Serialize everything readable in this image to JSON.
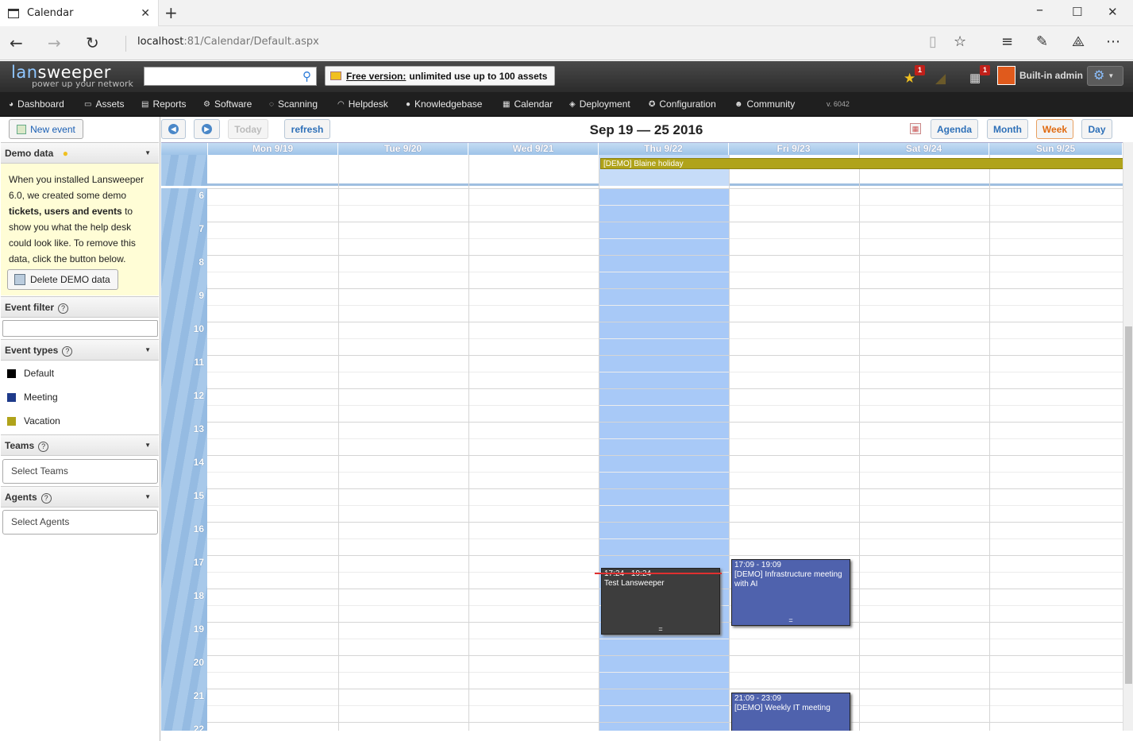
{
  "browser": {
    "tab_title": "Calendar",
    "url_host": "localhost",
    "url_rest": ":81/Calendar/Default.aspx"
  },
  "header": {
    "logo_lan": "lan",
    "logo_rest": "sweeper",
    "tagline": "power up your network",
    "free_label": "Free version:",
    "free_text": "unlimited use up to 100 assets",
    "notif_badge_1": "1",
    "notif_badge_2": "1",
    "username": "Built-in admin"
  },
  "nav": {
    "items": [
      "Dashboard",
      "Assets",
      "Reports",
      "Software",
      "Scanning",
      "Helpdesk",
      "Knowledgebase",
      "Calendar",
      "Deployment",
      "Configuration",
      "Community"
    ],
    "version": "v. 6042"
  },
  "sidebar": {
    "new_event": "New event",
    "demo_title": "Demo data",
    "demo_text_1": "When you installed Lansweeper 6.0, we created some demo ",
    "demo_bold": "tickets, users and events",
    "demo_text_2": " to show you what the help desk could look like. To remove this data, click the button below.",
    "delete_btn": "Delete DEMO data",
    "filter_title": "Event filter",
    "types_title": "Event types",
    "types": [
      {
        "name": "Default",
        "color": "#000000"
      },
      {
        "name": "Meeting",
        "color": "#1e3a8a"
      },
      {
        "name": "Vacation",
        "color": "#b0a31a"
      }
    ],
    "teams_title": "Teams",
    "teams_placeholder": "Select Teams",
    "agents_title": "Agents",
    "agents_placeholder": "Select Agents"
  },
  "toolbar": {
    "today": "Today",
    "refresh": "refresh",
    "range_title": "Sep 19 — 25 2016",
    "views": [
      "Agenda",
      "Month",
      "Week",
      "Day"
    ],
    "active_view": "Week"
  },
  "calendar": {
    "days": [
      "Mon 9/19",
      "Tue 9/20",
      "Wed 9/21",
      "Thu 9/22",
      "Fri 9/23",
      "Sat 9/24",
      "Sun 9/25"
    ],
    "hours": [
      "6",
      "7",
      "8",
      "9",
      "10",
      "11",
      "12",
      "13",
      "14",
      "15",
      "16",
      "17",
      "18",
      "19",
      "20",
      "21",
      "22"
    ],
    "allday_event": "[DEMO] Blaine holiday",
    "events": [
      {
        "time": "17:24 - 19:24",
        "title": "Test Lansweeper",
        "color": "#3d3d3d"
      },
      {
        "time": "17:09 - 19:09",
        "title": "[DEMO] Infrastructure meeting with AI",
        "color": "#4f62ad"
      },
      {
        "time": "21:09 - 23:09",
        "title": "[DEMO] Weekly IT meeting",
        "color": "#4f62ad"
      }
    ]
  }
}
